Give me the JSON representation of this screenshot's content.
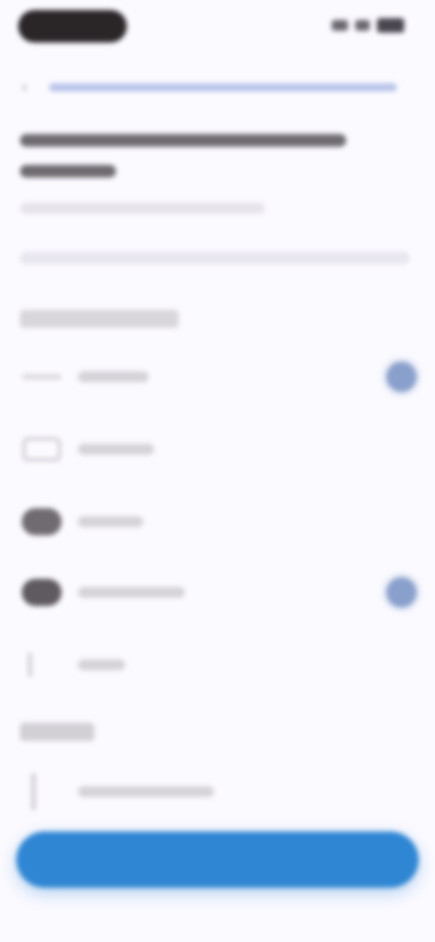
{
  "status_bar": {
    "time": "",
    "icons": [
      "signal-icon",
      "wifi-icon",
      "battery-icon"
    ]
  },
  "browser": {
    "back_icon": "back-arrow-icon",
    "url": ""
  },
  "page": {
    "title": "",
    "subtitle": "",
    "description": ""
  },
  "options_section": {
    "label": "",
    "items": [
      {
        "icon": "switch-icon",
        "label": "",
        "selected": true
      },
      {
        "icon": "device-icon",
        "label": "",
        "selected": false
      },
      {
        "icon": "cloud-icon",
        "label": "",
        "selected": false
      },
      {
        "icon": "cloud-upload-icon",
        "label": "",
        "selected": true
      },
      {
        "icon": "line-icon",
        "label": "",
        "selected": false
      }
    ]
  },
  "secondary_section": {
    "label": "",
    "item": {
      "icon": "person-icon",
      "label": ""
    }
  },
  "cta": {
    "label": ""
  },
  "colors": {
    "background": "#fbfaff",
    "accent": "#2f86d3",
    "radio": "#8aa0cc"
  }
}
